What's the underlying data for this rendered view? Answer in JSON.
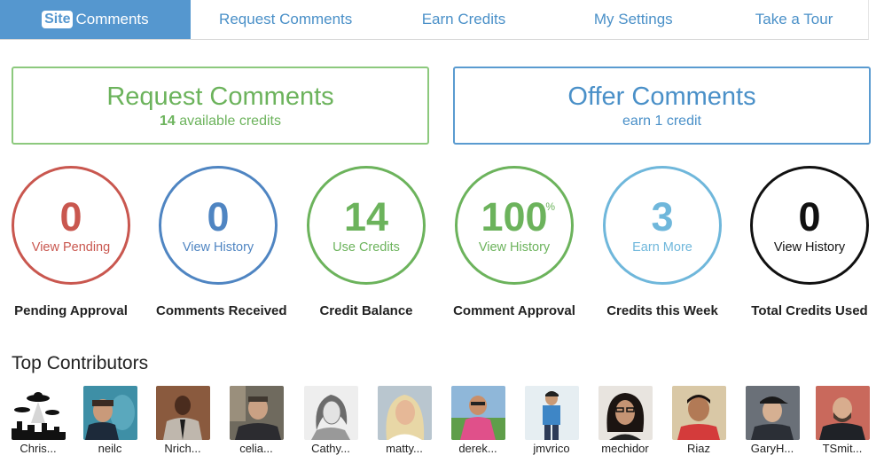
{
  "nav": {
    "brand_badge": "Site",
    "brand_label": "Comments",
    "items": [
      "Request Comments",
      "Earn Credits",
      "My Settings",
      "Take a Tour"
    ]
  },
  "request_box": {
    "title": "Request Comments",
    "credits_count": "14",
    "credits_text": "available credits"
  },
  "offer_box": {
    "title": "Offer Comments",
    "subtitle": "earn 1 credit"
  },
  "stats": [
    {
      "value": "0",
      "link": "View Pending",
      "label": "Pending Approval",
      "color": "#c9574f"
    },
    {
      "value": "0",
      "link": "View History",
      "label": "Comments Received",
      "color": "#4f85c2"
    },
    {
      "value": "14",
      "link": "Use Credits",
      "label": "Credit Balance",
      "color": "#6cb35c"
    },
    {
      "value": "100",
      "suffix": "%",
      "link": "View History",
      "label": "Comment Approval",
      "color": "#6cb35c"
    },
    {
      "value": "3",
      "link": "Earn More",
      "label": "Credits this Week",
      "color": "#6fb7db"
    },
    {
      "value": "0",
      "link": "View History",
      "label": "Total Credits Used",
      "color": "#111111"
    }
  ],
  "contributors": {
    "title": "Top Contributors",
    "people": [
      {
        "name": "Chris...",
        "avatar": "ufo-silhouette-avatar"
      },
      {
        "name": "neilc",
        "avatar": "man-with-dolphin-avatar"
      },
      {
        "name": "Nrich...",
        "avatar": "man-in-suit-avatar"
      },
      {
        "name": "celia...",
        "avatar": "man-at-desk-avatar"
      },
      {
        "name": "Cathy...",
        "avatar": "sketched-portrait-avatar"
      },
      {
        "name": "matty...",
        "avatar": "blonde-woman-avatar"
      },
      {
        "name": "derek...",
        "avatar": "man-in-pink-shirt-avatar"
      },
      {
        "name": "jmvrico",
        "avatar": "man-standing-avatar"
      },
      {
        "name": "mechidor",
        "avatar": "woman-with-glasses-avatar"
      },
      {
        "name": "Riaz",
        "avatar": "smiling-man-avatar"
      },
      {
        "name": "GaryH...",
        "avatar": "man-in-cap-avatar"
      },
      {
        "name": "TSmit...",
        "avatar": "bearded-man-avatar"
      }
    ]
  }
}
